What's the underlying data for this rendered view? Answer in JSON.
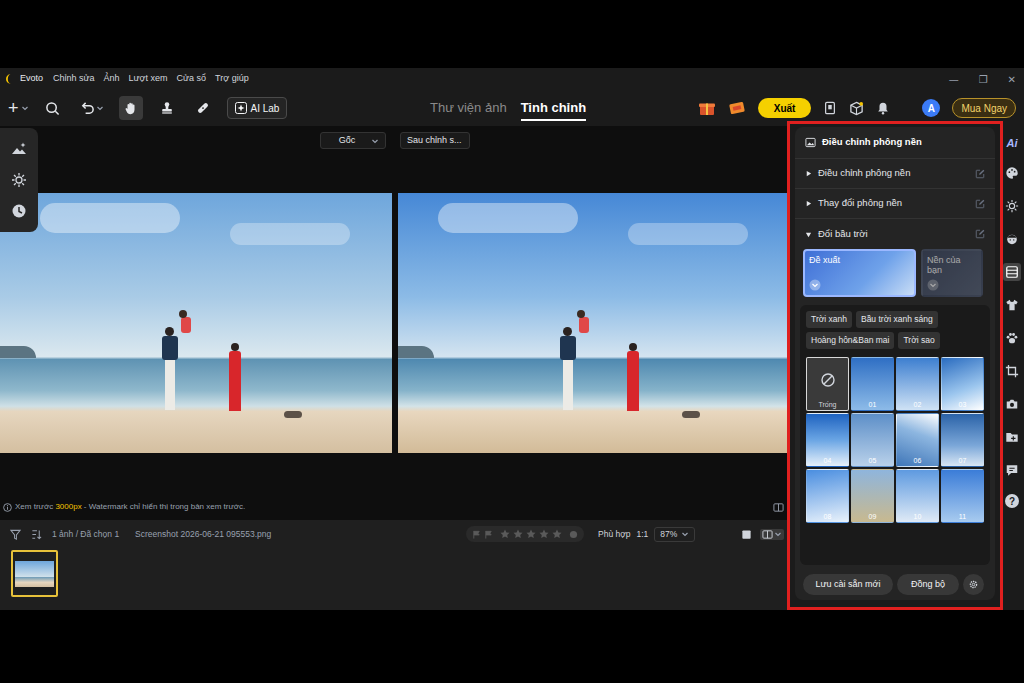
{
  "window": {
    "app": "Evoto",
    "menus": [
      "Chỉnh sửa",
      "Ảnh",
      "Lượt xem",
      "Cửa sổ",
      "Trợ giúp"
    ],
    "controls": [
      "—",
      "❐",
      "✕"
    ]
  },
  "toolbar": {
    "add": "+",
    "tools": [
      {
        "selected": false
      },
      {
        "selected": false
      },
      {
        "selected": true
      },
      {
        "selected": false
      },
      {
        "selected": false
      }
    ],
    "ai_lab": "AI Lab",
    "tabs": [
      {
        "label": "Thư viện ảnh",
        "selected": false
      },
      {
        "label": "Tinh chỉnh",
        "selected": true
      }
    ],
    "export": "Xuất",
    "avatar": "A",
    "buy": "Mua Ngay"
  },
  "compare": {
    "before": "Gốc",
    "after": "Sau chỉnh s..."
  },
  "preview_note": {
    "prefix": "Xem trước ",
    "size": "3000px",
    "suffix": " - Watermark chỉ hiển thị trong bản xem trước."
  },
  "filmstrip": {
    "count": "1 ảnh / Đã chọn 1",
    "file": "Screenshot 2026-06-21 095553.png",
    "stars": 0,
    "fit": "Phù hợp",
    "ratio": "1:1",
    "zoom": "87%",
    "thumbnails": [
      {
        "selected": true
      }
    ]
  },
  "panel": {
    "highlighted": true,
    "title": "Điều chỉnh phông nền",
    "sections": [
      {
        "label": "Điều chỉnh phông nền",
        "expanded": false
      },
      {
        "label": "Thay đổi phông nền",
        "expanded": false
      },
      {
        "label": "Đổi bầu trời",
        "expanded": true
      }
    ],
    "sources": [
      {
        "label": "Đề xuất",
        "selected": true
      },
      {
        "label": "Nền của bạn",
        "selected": false
      }
    ],
    "tags": [
      "Trời xanh",
      "Bầu trời xanh sáng",
      "Hoàng hôn&Ban mai",
      "Trời sao"
    ],
    "skies": [
      {
        "label": "Trống",
        "kind": "none",
        "selected": true
      },
      {
        "label": "01",
        "kind": "sky",
        "selected": false
      },
      {
        "label": "02",
        "kind": "sky",
        "selected": false
      },
      {
        "label": "03",
        "kind": "sky",
        "selected": false
      },
      {
        "label": "04",
        "kind": "sky",
        "selected": false
      },
      {
        "label": "05",
        "kind": "sky",
        "selected": false
      },
      {
        "label": "06",
        "kind": "sky",
        "selected": false
      },
      {
        "label": "07",
        "kind": "sky",
        "selected": false
      },
      {
        "label": "08",
        "kind": "sky",
        "selected": false
      },
      {
        "label": "09",
        "kind": "sky",
        "selected": false
      },
      {
        "label": "10",
        "kind": "sky",
        "selected": false
      },
      {
        "label": "11",
        "kind": "sky",
        "selected": false
      }
    ],
    "save": "Lưu cài sẵn mới",
    "sync": "Đồng bộ"
  },
  "sidebar": {
    "ai": "Ai",
    "tools": [
      {
        "selected": false
      },
      {
        "selected": false
      },
      {
        "selected": false
      },
      {
        "selected": true
      },
      {
        "selected": false
      },
      {
        "selected": false
      },
      {
        "selected": false
      },
      {
        "selected": false
      },
      {
        "selected": false
      },
      {
        "selected": false
      }
    ],
    "help": "?"
  }
}
